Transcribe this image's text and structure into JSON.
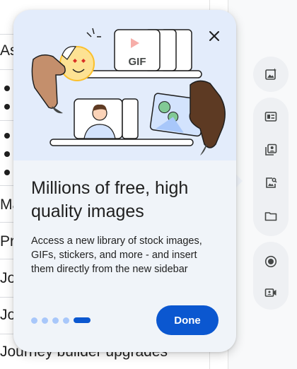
{
  "document": {
    "lines": [
      "As",
      "Ma",
      "Pro",
      "Jo",
      "Jo",
      "Journey builder upgrades"
    ]
  },
  "popover": {
    "close_icon": "close-icon",
    "title": "Millions of free, high quality images",
    "body": "Access a new library of stock images, GIFs, stickers, and more - and insert them directly from the new sidebar",
    "gif_label": "GIF",
    "done_label": "Done",
    "pagination": {
      "total": 5,
      "current": 5
    }
  },
  "sidebar": {
    "buttons": [
      {
        "icon": "image-sparkle-icon"
      },
      {
        "icon": "text-layout-icon"
      },
      {
        "icon": "photo-library-icon"
      },
      {
        "icon": "image-search-icon"
      },
      {
        "icon": "folder-icon"
      },
      {
        "icon": "record-icon"
      },
      {
        "icon": "video-camera-icon"
      }
    ]
  },
  "colors": {
    "primary": "#0b57d0",
    "popover_bg": "#f0f4f9",
    "illustration_bg": "#e3ecfb",
    "dot_inactive": "#a8c7fa"
  }
}
